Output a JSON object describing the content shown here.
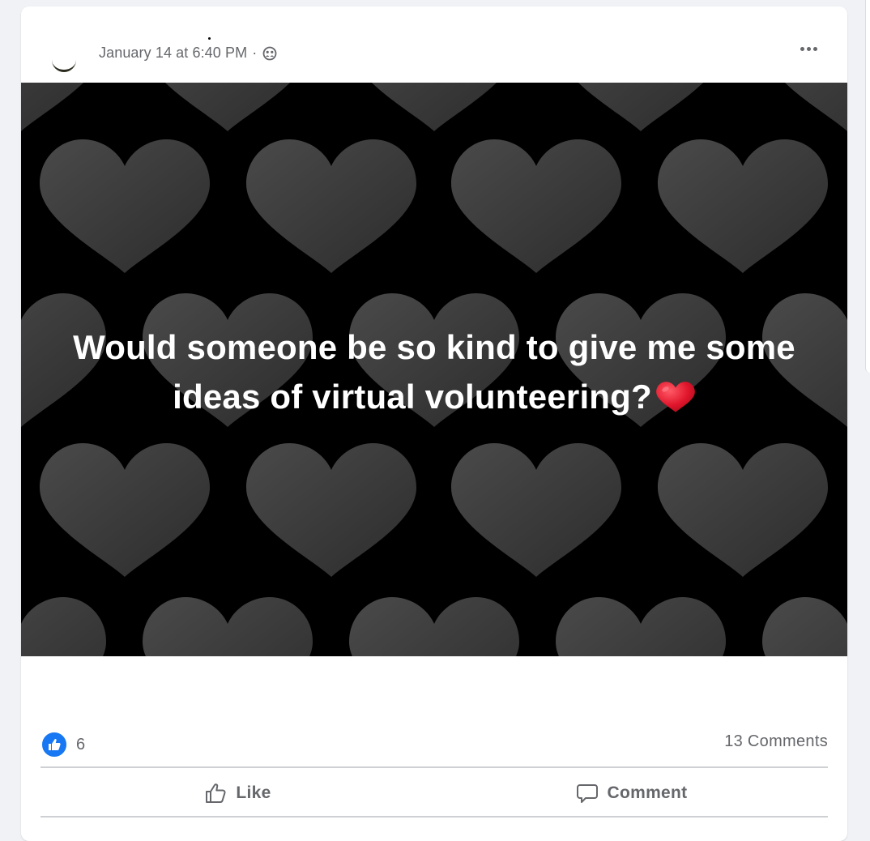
{
  "post": {
    "timestamp": "January 14 at 6:40 PM",
    "separator": "·",
    "privacy_icon": "friends-icon",
    "more_icon": "more-options-icon",
    "text_line1": "Would someone be so kind to give me some",
    "text_line2": "ideas of virtual volunteering?",
    "emoji": "red-heart-icon",
    "background": "dark-grey-hearts-pattern"
  },
  "stats": {
    "reaction_icon": "like-reaction-icon",
    "reaction_count": "6",
    "comments": "13 Comments"
  },
  "actions": {
    "like_label": "Like",
    "comment_label": "Comment"
  },
  "colors": {
    "accent": "#1877f2",
    "secondary_text": "#65676b",
    "heart": "#e0152b"
  }
}
